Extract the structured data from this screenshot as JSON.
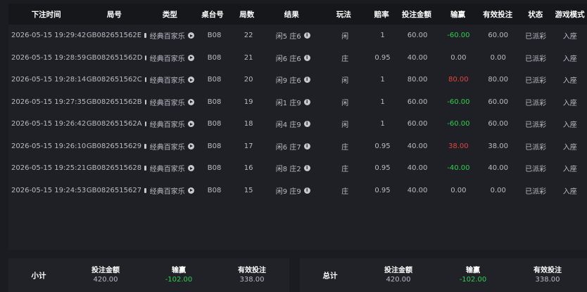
{
  "columns": {
    "time": "下注时间",
    "id": "局号",
    "type": "类型",
    "table": "桌台号",
    "round": "局数",
    "result": "结果",
    "play": "玩法",
    "odds": "赔率",
    "amount": "投注金额",
    "winloss": "输赢",
    "effective": "有效投注",
    "status": "状态",
    "mode": "游戏模式"
  },
  "rows": [
    {
      "time": "2026-05-15 19:29:42",
      "id": "GB082651562E",
      "type": "经典百家乐",
      "table": "B08",
      "round": "22",
      "result": "闲5 庄6",
      "play": "闲",
      "odds": "1",
      "amount": "60.00",
      "winloss": "-60.00",
      "effective": "60.00",
      "status": "已派彩",
      "mode": "入座",
      "sign": "neg"
    },
    {
      "time": "2026-05-15 19:28:59",
      "id": "GB082651562D",
      "type": "经典百家乐",
      "table": "B08",
      "round": "21",
      "result": "闲6 庄6",
      "play": "庄",
      "odds": "0.95",
      "amount": "40.00",
      "winloss": "0.00",
      "effective": "0.00",
      "status": "已派彩",
      "mode": "入座",
      "sign": "zero"
    },
    {
      "time": "2026-05-15 19:28:14",
      "id": "GB082651562C",
      "type": "经典百家乐",
      "table": "B08",
      "round": "20",
      "result": "闲9 庄6",
      "play": "闲",
      "odds": "1",
      "amount": "80.00",
      "winloss": "80.00",
      "effective": "80.00",
      "status": "已派彩",
      "mode": "入座",
      "sign": "pos"
    },
    {
      "time": "2026-05-15 19:27:35",
      "id": "GB082651562B",
      "type": "经典百家乐",
      "table": "B08",
      "round": "19",
      "result": "闲1 庄9",
      "play": "闲",
      "odds": "1",
      "amount": "60.00",
      "winloss": "-60.00",
      "effective": "60.00",
      "status": "已派彩",
      "mode": "入座",
      "sign": "neg"
    },
    {
      "time": "2026-05-15 19:26:42",
      "id": "GB082651562A",
      "type": "经典百家乐",
      "table": "B08",
      "round": "18",
      "result": "闲4 庄9",
      "play": "闲",
      "odds": "1",
      "amount": "60.00",
      "winloss": "-60.00",
      "effective": "60.00",
      "status": "已派彩",
      "mode": "入座",
      "sign": "neg"
    },
    {
      "time": "2026-05-15 19:26:10",
      "id": "GB0826515629",
      "type": "经典百家乐",
      "table": "B08",
      "round": "17",
      "result": "闲6 庄7",
      "play": "庄",
      "odds": "0.95",
      "amount": "40.00",
      "winloss": "38.00",
      "effective": "38.00",
      "status": "已派彩",
      "mode": "入座",
      "sign": "pos"
    },
    {
      "time": "2026-05-15 19:25:21",
      "id": "GB0826515628",
      "type": "经典百家乐",
      "table": "B08",
      "round": "16",
      "result": "闲8 庄2",
      "play": "庄",
      "odds": "0.95",
      "amount": "40.00",
      "winloss": "-40.00",
      "effective": "40.00",
      "status": "已派彩",
      "mode": "入座",
      "sign": "neg"
    },
    {
      "time": "2026-05-15 19:24:53",
      "id": "GB0826515627",
      "type": "经典百家乐",
      "table": "B08",
      "round": "15",
      "result": "闲9 庄9",
      "play": "庄",
      "odds": "0.95",
      "amount": "40.00",
      "winloss": "0.00",
      "effective": "0.00",
      "status": "已派彩",
      "mode": "入座",
      "sign": "zero"
    }
  ],
  "subtotal": {
    "label": "小计",
    "amount_head": "投注金额",
    "amount": "420.00",
    "winloss_head": "输赢",
    "winloss": "-102.00",
    "effective_head": "有效投注",
    "effective": "338.00"
  },
  "total": {
    "label": "总计",
    "amount_head": "投注金额",
    "amount": "420.00",
    "winloss_head": "输赢",
    "winloss": "-102.00",
    "effective_head": "有效投注",
    "effective": "338.00"
  },
  "colors": {
    "loss": "#2fcf4f",
    "win": "#e2453c"
  },
  "icons": {
    "copy": "copy-icon",
    "play": "play-icon",
    "info": "info-icon"
  }
}
